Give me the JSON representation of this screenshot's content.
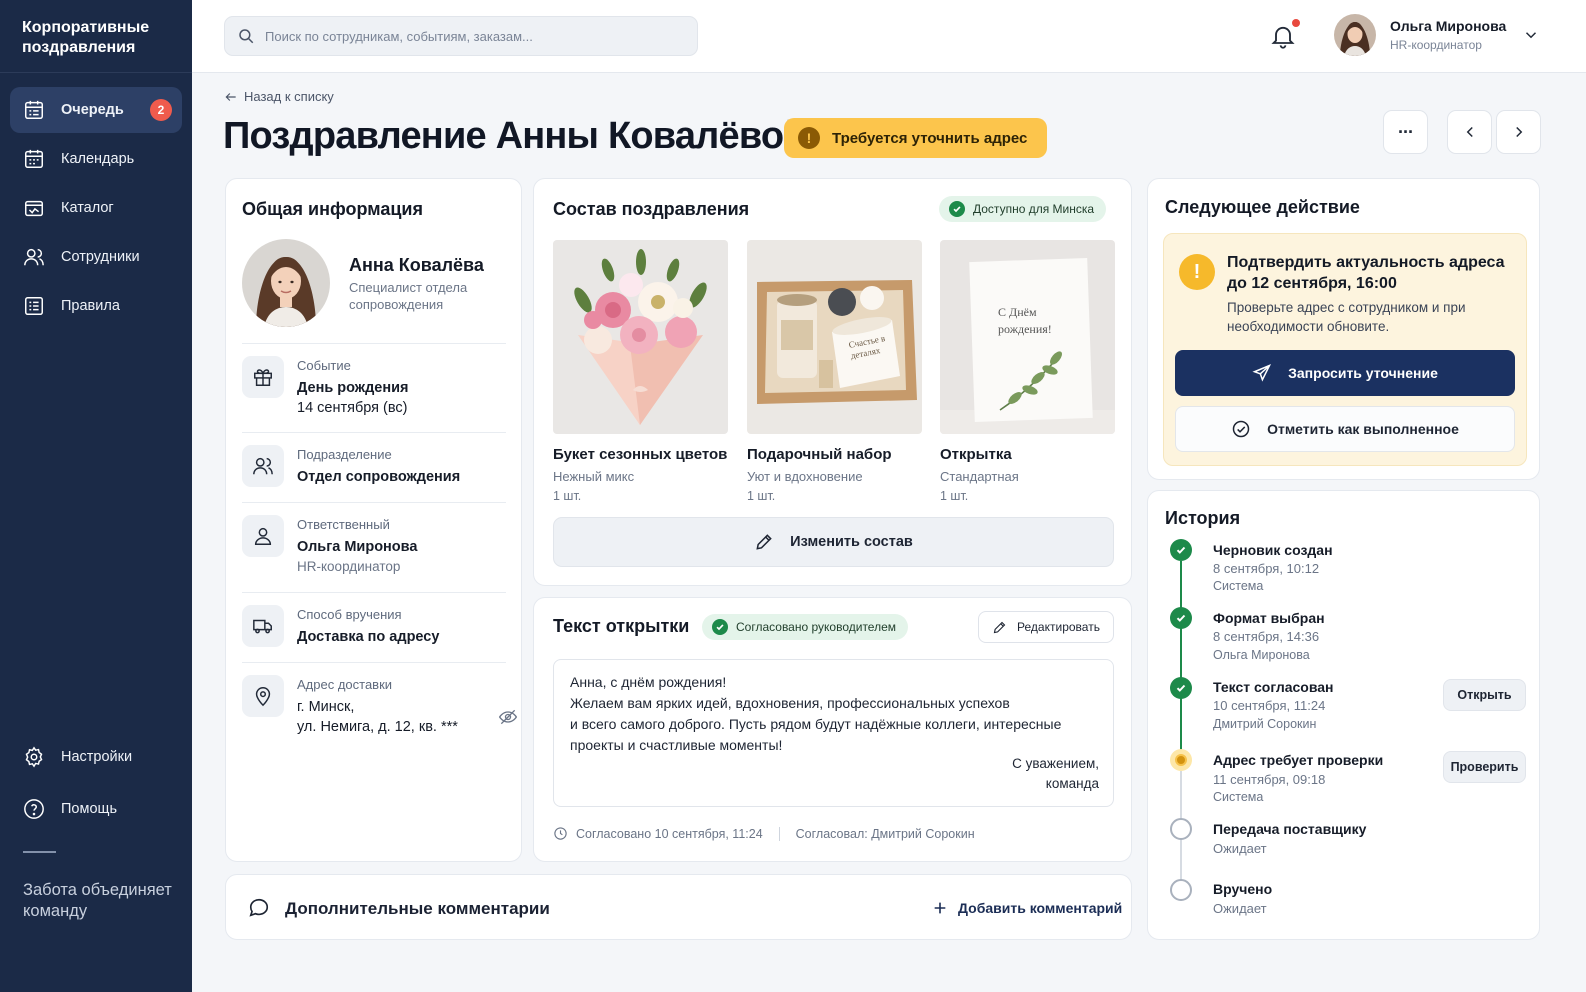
{
  "sidebar": {
    "brand": "Корпоративные поздравления",
    "items": [
      {
        "label": "Очередь",
        "badge": "2",
        "icon": "queue-icon"
      },
      {
        "label": "Календарь",
        "icon": "calendar-icon"
      },
      {
        "label": "Каталог",
        "icon": "catalog-icon"
      },
      {
        "label": "Сотрудники",
        "icon": "users-icon"
      },
      {
        "label": "Правила",
        "icon": "rules-icon"
      }
    ],
    "bottom": [
      {
        "label": "Настройки",
        "icon": "gear-icon"
      },
      {
        "label": "Помощь",
        "icon": "help-icon"
      }
    ],
    "tagline": "Забота объединяет команду"
  },
  "topbar": {
    "search_placeholder": "Поиск по сотрудникам, событиям, заказам...",
    "user_name": "Ольга Миронова",
    "user_role": "HR-координатор"
  },
  "header": {
    "back_label": "Назад к списку",
    "title": "Поздравление Анны Ковалёвой",
    "status": "Требуется уточнить адрес",
    "more_label": "···"
  },
  "general": {
    "title": "Общая информация",
    "person_name": "Анна Ковалёва",
    "person_role": "Специалист отдела сопровождения",
    "event_label": "Событие",
    "event_value": "День рождения",
    "event_date": "14 сентября (вс)",
    "dept_label": "Подразделение",
    "dept_value": "Отдел сопровождения",
    "owner_label": "Ответственный",
    "owner_value": "Ольга Миронова",
    "owner_role": "HR-координатор",
    "delivery_label": "Способ вручения",
    "delivery_value": "Доставка по адресу",
    "address_label": "Адрес доставки",
    "address_line1": "г. Минск,",
    "address_line2": "ул. Немига, д. 12, кв. ***"
  },
  "composition": {
    "title": "Состав поздравления",
    "availability": "Доступно для Минска",
    "products": [
      {
        "name": "Букет сезонных цветов",
        "desc": "Нежный микс",
        "qty": "1 шт."
      },
      {
        "name": "Подарочный набор",
        "desc": "Уют и вдохновение",
        "qty": "1 шт.",
        "label": "Счастье в деталях"
      },
      {
        "name": "Открытка",
        "desc": "Стандартная",
        "qty": "1 шт.",
        "label": "С Днём рождения!"
      }
    ],
    "change_label": "Изменить состав"
  },
  "card_text": {
    "title": "Текст открытки",
    "approval": "Согласовано руководителем",
    "edit_label": "Редактировать",
    "body": "Анна, с днём рождения!\nЖелаем вам ярких идей, вдохновения, профессиональных успехов\nи всего самого доброго. Пусть рядом будут надёжные коллеги, интересные\nпроекты и счастливые моменты!",
    "signature": "С уважением,\nкоманда",
    "approved_at": "Согласовано 10 сентября, 11:24",
    "approved_by": "Согласовал: Дмитрий Сорокин"
  },
  "comments": {
    "title": "Дополнительные комментарии",
    "add_label": "Добавить комментарий"
  },
  "next_action": {
    "title": "Следующее действие",
    "alert_title": "Подтвердить актуальность адреса до 12 сентября, 16:00",
    "alert_text": "Проверьте адрес с сотрудником и при необходимости обновите.",
    "primary_label": "Запросить уточнение",
    "secondary_label": "Отметить как выполненное"
  },
  "history": {
    "title": "История",
    "items": [
      {
        "title": "Черновик создан",
        "date": "8 сентября, 10:12",
        "by": "Система",
        "state": "done"
      },
      {
        "title": "Формат выбран",
        "date": "8 сентября, 14:36",
        "by": "Ольга Миронова",
        "state": "done"
      },
      {
        "title": "Текст согласован",
        "date": "10 сентября, 11:24",
        "by": "Дмитрий Сорокин",
        "state": "done",
        "action": "Открыть"
      },
      {
        "title": "Адрес требует проверки",
        "date": "11 сентября, 09:18",
        "by": "Система",
        "state": "warning",
        "action": "Проверить"
      },
      {
        "title": "Передача поставщику",
        "date": "Ожидает",
        "state": "pending"
      },
      {
        "title": "Вручено",
        "date": "Ожидает",
        "state": "pending"
      }
    ]
  },
  "colors": {
    "sidebar": "#1b2a47",
    "accent": "#1b3161",
    "warning": "#fcc54c",
    "success": "#1d8a4a"
  }
}
